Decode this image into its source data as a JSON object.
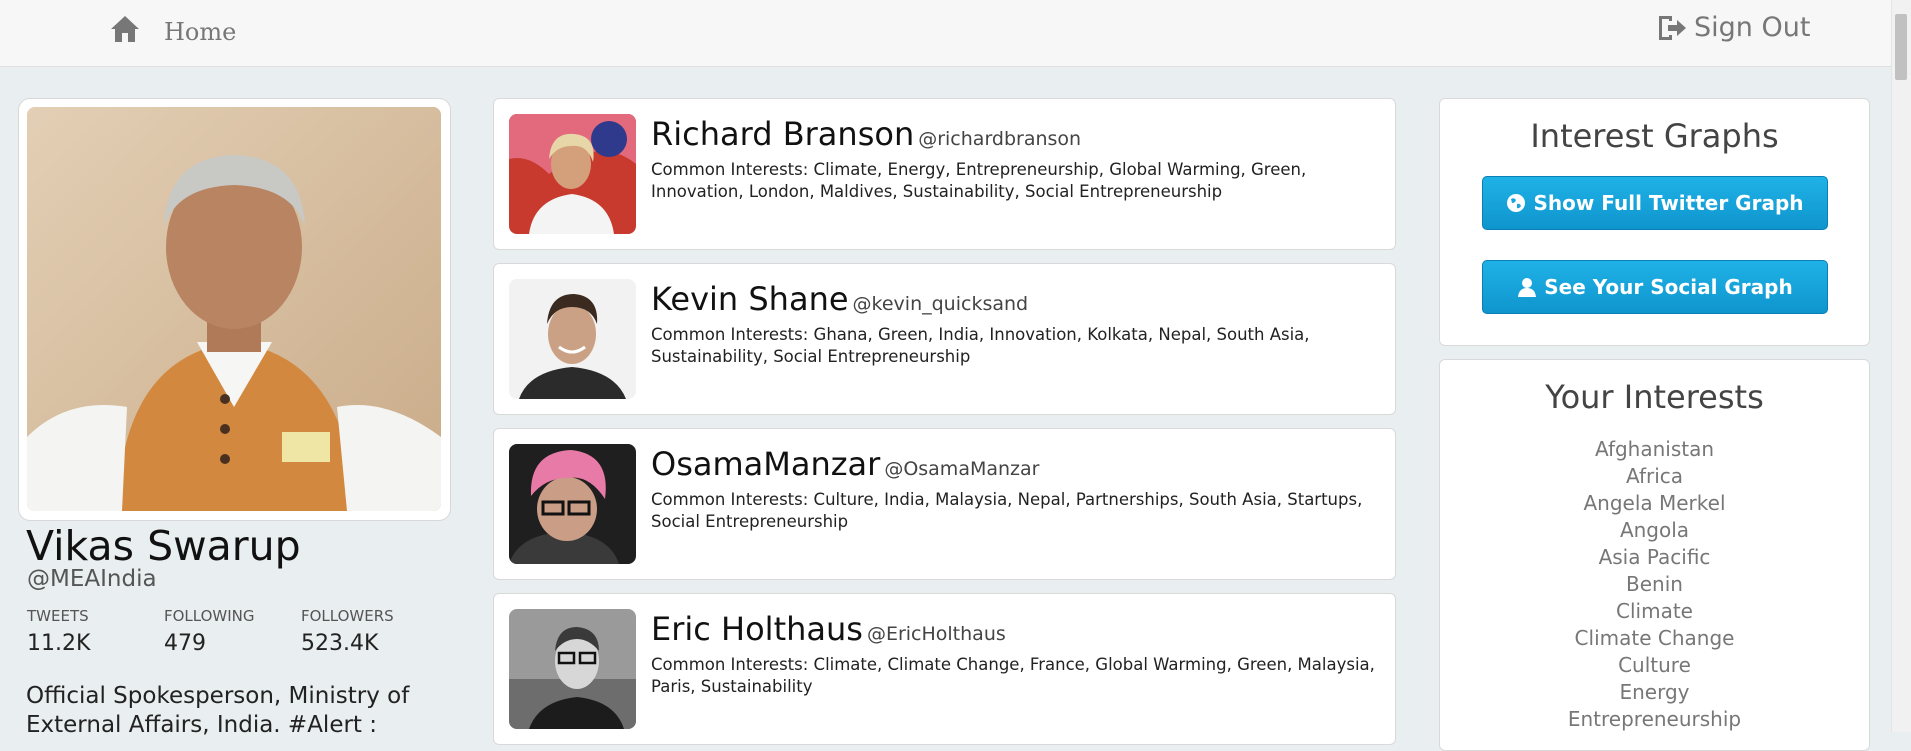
{
  "nav": {
    "home_label": "Home",
    "signout_label": "Sign Out",
    "home_icon": "home-icon",
    "signout_icon": "sign-out-icon"
  },
  "profile": {
    "name": "Vikas Swarup",
    "handle": "@MEAIndia",
    "stats": [
      {
        "label": "TWEETS",
        "value": "11.2K"
      },
      {
        "label": "FOLLOWING",
        "value": "479"
      },
      {
        "label": "FOLLOWERS",
        "value": "523.4K"
      }
    ],
    "bio": "Official Spokesperson, Ministry of External Affairs, India. #Alert :"
  },
  "people": [
    {
      "name": "Richard Branson",
      "handle": "@richardbranson",
      "interests": "Common Interests: Climate, Energy, Entrepreneurship, Global Warming, Green, Innovation, London, Maldives, Sustainability, Social Entrepreneurship"
    },
    {
      "name": "Kevin Shane",
      "handle": "@kevin_quicksand",
      "interests": "Common Interests: Ghana, Green, India, Innovation, Kolkata, Nepal, South Asia, Sustainability, Social Entrepreneurship"
    },
    {
      "name": "OsamaManzar",
      "handle": "@OsamaManzar",
      "interests": "Common Interests: Culture, India, Malaysia, Nepal, Partnerships, South Asia, Startups, Social Entrepreneurship"
    },
    {
      "name": "Eric Holthaus",
      "handle": "@EricHolthaus",
      "interests": "Common Interests: Climate, Climate Change, France, Global Warming, Green, Malaysia, Paris, Sustainability"
    }
  ],
  "graphs": {
    "title": "Interest Graphs",
    "full_graph_label": "Show Full Twitter Graph",
    "social_graph_label": "See Your Social Graph",
    "full_graph_icon": "globe-icon",
    "social_graph_icon": "user-icon"
  },
  "your_interests": {
    "title": "Your Interests",
    "items": [
      "Afghanistan",
      "Africa",
      "Angela Merkel",
      "Angola",
      "Asia Pacific",
      "Benin",
      "Climate",
      "Climate Change",
      "Culture",
      "Energy",
      "Entrepreneurship"
    ]
  },
  "colors": {
    "button_blue": "#1aa6dc",
    "background": "#e9eef0"
  }
}
